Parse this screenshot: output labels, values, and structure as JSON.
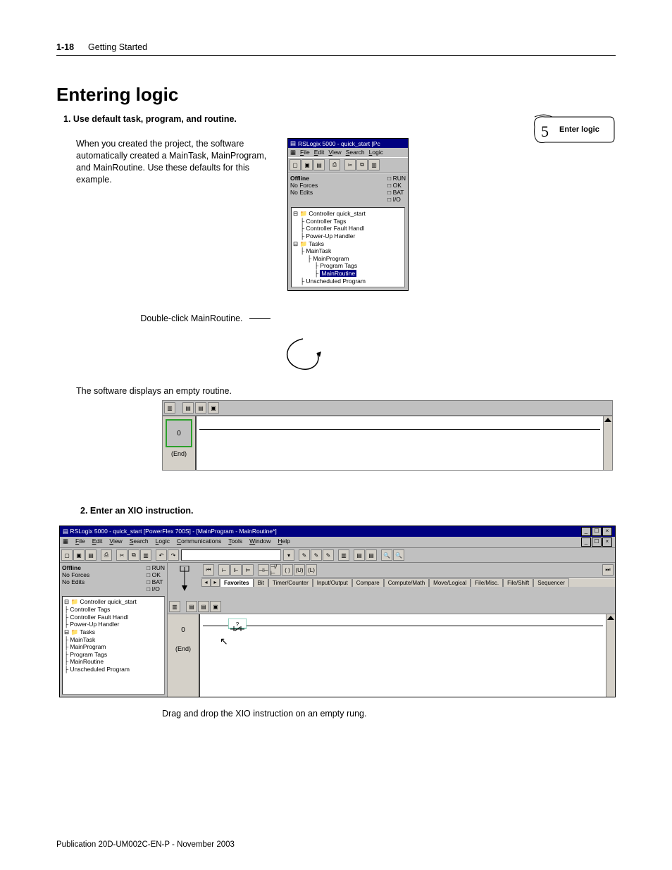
{
  "header": {
    "page_num": "1-18",
    "chapter": "Getting Started"
  },
  "title": "Entering logic",
  "callout": {
    "num": "5",
    "label": "Enter logic"
  },
  "step1": {
    "heading": "1.    Use default task, program, and routine.",
    "para": "When you created the project, the software automatically created a MainTask, MainProgram, and MainRoutine. Use these defaults for this example.",
    "double_click": "Double-click MainRoutine.",
    "empty_text": "The software displays an empty routine."
  },
  "rsl_small": {
    "title": "RSLogix 5000 - quick_start [Pc",
    "menus": [
      "File",
      "Edit",
      "View",
      "Search",
      "Logic"
    ],
    "status_left": [
      "Offline",
      "No Forces",
      "No Edits"
    ],
    "status_right": [
      "RUN",
      "OK",
      "BAT",
      "I/O"
    ],
    "tree": [
      {
        "lvl": 0,
        "t": "Controller quick_start"
      },
      {
        "lvl": 1,
        "t": "Controller Tags"
      },
      {
        "lvl": 1,
        "t": "Controller Fault Handl"
      },
      {
        "lvl": 1,
        "t": "Power-Up Handler"
      },
      {
        "lvl": 0,
        "t": "Tasks"
      },
      {
        "lvl": 1,
        "t": "MainTask"
      },
      {
        "lvl": 2,
        "t": "MainProgram"
      },
      {
        "lvl": 3,
        "t": "Program Tags"
      },
      {
        "lvl": 3,
        "t": "MainRoutine",
        "sel": true
      },
      {
        "lvl": 1,
        "t": "Unscheduled Program"
      }
    ]
  },
  "rung_top": {
    "num": "0",
    "end": "(End)"
  },
  "step2": {
    "heading": "2.  Enter an XIO instruction.",
    "caption": "Drag and drop the XIO instruction on an empty rung."
  },
  "rsl_large": {
    "title": "RSLogix 5000 - quick_start [PowerFlex 700S] - [MainProgram - MainRoutine*]",
    "menus": [
      "File",
      "Edit",
      "View",
      "Search",
      "Logic",
      "Communications",
      "Tools",
      "Window",
      "Help"
    ],
    "status_left": [
      "Offline",
      "No Forces",
      "No Edits"
    ],
    "status_right": [
      "RUN",
      "OK",
      "BAT",
      "I/O"
    ],
    "tabs": [
      "Favorites",
      "Bit",
      "Timer/Counter",
      "Input/Output",
      "Compare",
      "Compute/Math",
      "Move/Logical",
      "File/Misc.",
      "File/Shift",
      "Sequencer"
    ],
    "tree": [
      {
        "lvl": 0,
        "t": "Controller quick_start"
      },
      {
        "lvl": 1,
        "t": "Controller Tags"
      },
      {
        "lvl": 1,
        "t": "Controller Fault Handl"
      },
      {
        "lvl": 1,
        "t": "Power-Up Handler"
      },
      {
        "lvl": 0,
        "t": "Tasks"
      },
      {
        "lvl": 1,
        "t": "MainTask"
      },
      {
        "lvl": 2,
        "t": "MainProgram"
      },
      {
        "lvl": 3,
        "t": "Program Tags"
      },
      {
        "lvl": 3,
        "t": "MainRoutine",
        "sel": true
      },
      {
        "lvl": 1,
        "t": "Unscheduled Program"
      }
    ],
    "rung_num": "0",
    "rung_end": "(End)"
  },
  "footer": "Publication 20D-UM002C-EN-P - November 2003"
}
